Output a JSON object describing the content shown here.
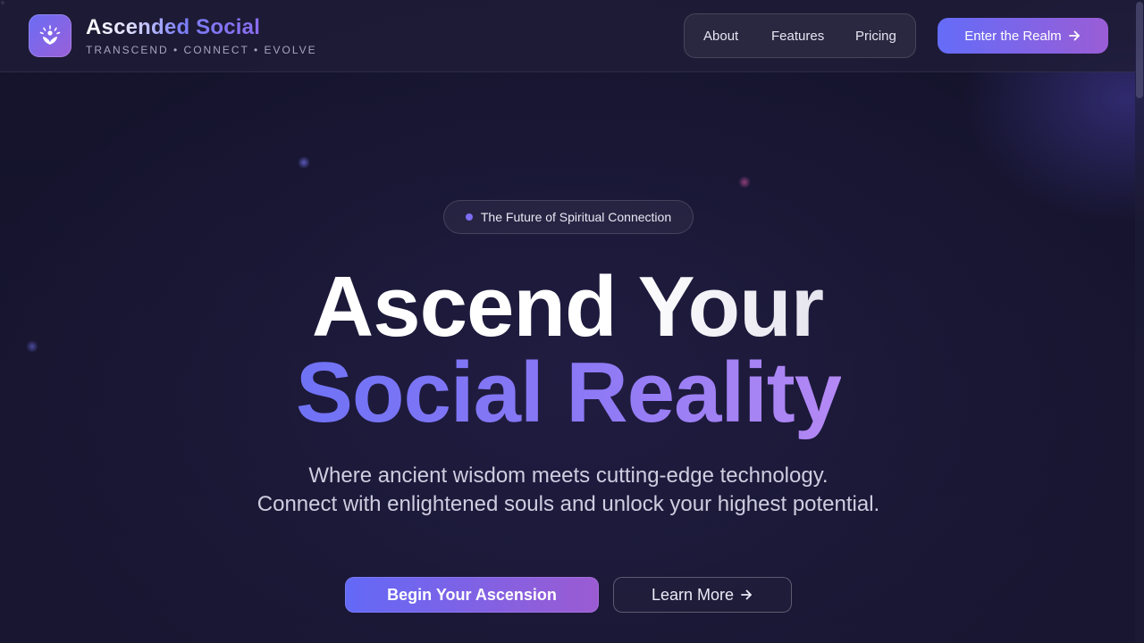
{
  "header": {
    "brand_name": "Ascended Social",
    "brand_tagline": "TRANSCEND • CONNECT • EVOLVE",
    "logo_icon": "lotus-icon",
    "nav": [
      {
        "label": "About"
      },
      {
        "label": "Features"
      },
      {
        "label": "Pricing"
      }
    ],
    "cta_label": "Enter the Realm",
    "cta_icon": "arrow-right-icon"
  },
  "hero": {
    "badge": "The Future of Spiritual Connection",
    "title_line1": "Ascend Your",
    "title_line2": "Social Reality",
    "subtitle_line1": "Where ancient wisdom meets cutting-edge technology.",
    "subtitle_line2": "Connect with enlightened souls and unlock your highest potential.",
    "primary_cta": "Begin Your Ascension",
    "secondary_cta": "Learn More",
    "secondary_icon": "arrow-right-icon"
  },
  "colors": {
    "background": "#131229",
    "accent_start": "#646cf8",
    "accent_end": "#9a5dd6",
    "badge_dot": "#7c6df2"
  }
}
